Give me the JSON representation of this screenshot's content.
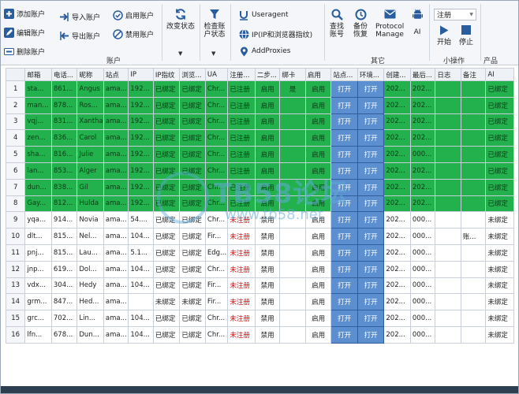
{
  "ribbon": {
    "account": {
      "add": "添加账户",
      "edit": "编辑账户",
      "delete": "删除账户",
      "import": "导入账户",
      "export": "导出账户",
      "enable": "启用账户",
      "disable": "禁用账户",
      "group": "账户"
    },
    "change_status": "改变状态",
    "check_status": "检查账户状态",
    "useragent": "Useragent",
    "ip_fingerprint": "IP(IP和浏览器指纹)",
    "add_proxies": "AddProxies",
    "find_account": "查找账号",
    "backup_restore": "备份恢复",
    "protocol_manage": "Protocol Manage",
    "ai": "AI",
    "other_group": "其它",
    "register_combo": "注册",
    "start": "开始",
    "stop": "停止",
    "small_ops_group": "小操作",
    "product_group": "产品"
  },
  "table": {
    "headers": [
      "",
      "邮箱",
      "电话...",
      "昵称",
      "站点",
      "IP",
      "IP指纹",
      "浏览...",
      "UA",
      "注册...",
      "二步...",
      "绑卡",
      "启用",
      "站点...",
      "环境...",
      "创建...",
      "最后...",
      "日志",
      "备注",
      "AI"
    ],
    "rows": [
      {
        "n": "1",
        "c": [
          "sta...",
          "861...",
          "Angus",
          "ama...",
          "192...",
          "已绑定",
          "已绑定",
          "Chr...",
          "已注册",
          "启用",
          "是",
          "启用",
          "打开",
          "打开",
          "202...",
          "202...",
          "",
          "",
          "已绑定"
        ]
      },
      {
        "n": "2",
        "c": [
          "man...",
          "878...",
          "Ros...",
          "ama...",
          "192...",
          "已绑定",
          "已绑定",
          "Chr...",
          "已注册",
          "启用",
          "",
          "启用",
          "打开",
          "打开",
          "202...",
          "202...",
          "",
          "",
          "已绑定"
        ]
      },
      {
        "n": "3",
        "c": [
          "vqj...",
          "831...",
          "Xantha",
          "ama...",
          "192...",
          "已绑定",
          "已绑定",
          "Chr...",
          "已注册",
          "启用",
          "",
          "启用",
          "打开",
          "打开",
          "202...",
          "202...",
          "",
          "",
          "已绑定"
        ]
      },
      {
        "n": "4",
        "c": [
          "zen...",
          "836...",
          "Carol",
          "ama...",
          "192...",
          "已绑定",
          "已绑定",
          "Chr...",
          "已注册",
          "启用",
          "",
          "启用",
          "打开",
          "打开",
          "202...",
          "202...",
          "",
          "",
          "已绑定"
        ]
      },
      {
        "n": "5",
        "c": [
          "sha...",
          "816...",
          "Julie",
          "ama...",
          "192...",
          "已绑定",
          "已绑定",
          "Chr...",
          "已注册",
          "启用",
          "",
          "启用",
          "打开",
          "打开",
          "202...",
          "000...",
          "",
          "",
          "已绑定"
        ]
      },
      {
        "n": "6",
        "c": [
          "lan...",
          "853...",
          "Alger",
          "ama...",
          "192...",
          "已绑定",
          "已绑定",
          "Chr...",
          "已注册",
          "启用",
          "",
          "启用",
          "打开",
          "打开",
          "202...",
          "202...",
          "",
          "",
          "已绑定"
        ]
      },
      {
        "n": "7",
        "c": [
          "dun...",
          "838...",
          "Gil",
          "ama...",
          "192...",
          "已绑定",
          "已绑定",
          "Chr...",
          "已注册",
          "启用",
          "",
          "启用",
          "打开",
          "打开",
          "202...",
          "202...",
          "",
          "",
          "已绑定"
        ]
      },
      {
        "n": "8",
        "c": [
          "Gay...",
          "812...",
          "Hulda",
          "ama...",
          "192...",
          "已绑定",
          "已绑定",
          "Chr...",
          "已注册",
          "启用",
          "",
          "启用",
          "打开",
          "打开",
          "202...",
          "202...",
          "",
          "",
          "已绑定"
        ]
      },
      {
        "n": "9",
        "c": [
          "yqa...",
          "914...",
          "Novia",
          "ama...",
          "54....",
          "已绑定",
          "已绑定",
          "Chr...",
          "未注册",
          "禁用",
          "",
          "启用",
          "打开",
          "打开",
          "202...",
          "000...",
          "",
          "",
          "未绑定"
        ]
      },
      {
        "n": "10",
        "c": [
          "dlt...",
          "815...",
          "Nel...",
          "ama...",
          "104...",
          "已绑定",
          "已绑定",
          "Fir...",
          "未注册",
          "禁用",
          "",
          "启用",
          "打开",
          "打开",
          "202...",
          "000...",
          "",
          "账...",
          "未绑定"
        ]
      },
      {
        "n": "11",
        "c": [
          "pnj...",
          "815...",
          "Lau...",
          "ama...",
          "5.1...",
          "已绑定",
          "已绑定",
          "Edg...",
          "未注册",
          "禁用",
          "",
          "启用",
          "打开",
          "打开",
          "202...",
          "000...",
          "",
          "",
          "未绑定"
        ]
      },
      {
        "n": "12",
        "c": [
          "jnp...",
          "619...",
          "Dol...",
          "ama...",
          "104...",
          "已绑定",
          "已绑定",
          "Chr...",
          "未注册",
          "禁用",
          "",
          "启用",
          "打开",
          "打开",
          "202...",
          "000...",
          "",
          "",
          "未绑定"
        ]
      },
      {
        "n": "13",
        "c": [
          "vdx...",
          "304...",
          "Hedy",
          "ama...",
          "104...",
          "已绑定",
          "已绑定",
          "Fir...",
          "未注册",
          "禁用",
          "",
          "启用",
          "打开",
          "打开",
          "202...",
          "000...",
          "",
          "",
          "未绑定"
        ]
      },
      {
        "n": "14",
        "c": [
          "grm...",
          "847...",
          "Hed...",
          "ama...",
          "",
          "未绑定",
          "未绑定",
          "Fir...",
          "未注册",
          "禁用",
          "",
          "启用",
          "打开",
          "打开",
          "202...",
          "000...",
          "",
          "",
          "未绑定"
        ]
      },
      {
        "n": "15",
        "c": [
          "grc...",
          "702...",
          "Lin...",
          "ama...",
          "104...",
          "已绑定",
          "已绑定",
          "Chr...",
          "未注册",
          "禁用",
          "",
          "启用",
          "打开",
          "打开",
          "202...",
          "000...",
          "",
          "",
          "未绑定"
        ]
      },
      {
        "n": "16",
        "c": [
          "lfn...",
          "678...",
          "Dun...",
          "ama...",
          "104...",
          "已绑定",
          "已绑定",
          "Chr...",
          "未注册",
          "禁用",
          "",
          "启用",
          "打开",
          "打开",
          "202...",
          "000...",
          "",
          "",
          "未绑定"
        ]
      }
    ]
  },
  "watermark": {
    "text": "TB58论坛",
    "url": "www.tb58.net"
  },
  "colors": {
    "registered_row": "#22b14c",
    "open_button": "#5b8fd0",
    "unregistered_text": "#e00000",
    "ribbon_icon": "#2a5d9e"
  },
  "icons": {
    "add": "plus-icon",
    "edit": "pencil-icon",
    "delete": "delete-icon",
    "import": "arrow-right-icon",
    "export": "arrow-left-icon",
    "enable": "check-circle-icon",
    "disable": "block-circle-icon",
    "change_status": "refresh-icon",
    "check_status": "filter-icon",
    "useragent": "underline-u-icon",
    "ip": "globe-icon",
    "proxies": "location-pin-icon",
    "find": "search-icon",
    "backup": "clock-icon",
    "protocol": "mail-icon",
    "ai": "android-icon",
    "start": "play-icon",
    "stop": "stop-icon"
  }
}
